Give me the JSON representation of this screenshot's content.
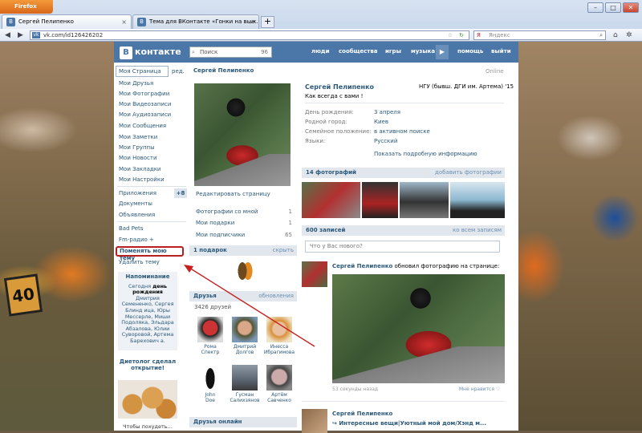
{
  "browser": {
    "app_button": "Firefox",
    "tabs": [
      {
        "title": "Сергей Пелипенко"
      },
      {
        "title": "Тема для ВКонтакте «Гонки на выж..."
      }
    ],
    "url": "vk.com/id126426202",
    "search_placeholder": "Яндекс"
  },
  "vk": {
    "logo": "контакте",
    "search_placeholder": "Поиск",
    "search_count": "96",
    "nav": [
      "люди",
      "сообщества",
      "игры",
      "музыка",
      "помощь",
      "выйти"
    ]
  },
  "sidebar": {
    "selected": "Моя Страница",
    "edit_short": "ред.",
    "items": [
      "Мои Друзья",
      "Мои Фотографии",
      "Мои Видеозаписи",
      "Мои Аудиозаписи",
      "Мои Сообщения",
      "Мои Заметки",
      "Мои Группы",
      "Мои Новости",
      "Мои Закладки",
      "Мои Настройки"
    ],
    "apps": [
      "Приложения",
      "Документы",
      "Объявления"
    ],
    "apps_badge": "+8",
    "extra": [
      "Bad Pets",
      "Fm-радио +"
    ],
    "change_theme": "Поменять мою тему",
    "delete_theme": "Удалить тему",
    "reminder": {
      "title": "Напоминание",
      "pre": "Сегодня",
      "bold": "день рождения",
      "names": "Дмитрия Семененко, Сергея Блинд ица, Юры Мессерле, Миши Подоляка, Эльдара Абзалова, Юлии Суворовой, Артема Барехович а."
    },
    "ad_title": "Диетолог сделал открытие!",
    "ad_caption": "Чтобы похудеть..."
  },
  "profile": {
    "header_name": "Сергей Пелипенко",
    "online": "Online",
    "name": "Сергей Пелипенко",
    "university": "НГУ (бывш. ДГИ им. Артема) '15",
    "status": "Как всегда с вами !",
    "info": [
      {
        "k": "День рождения:",
        "v": "3 апреля"
      },
      {
        "k": "Родной город:",
        "v": "Киев"
      },
      {
        "k": "Семейное положение:",
        "v": "в активном поиске"
      },
      {
        "k": "Языки:",
        "v": "Русский"
      }
    ],
    "show_more": "Показать подробную информацию",
    "edit_page": "Редактировать страницу",
    "meta": [
      {
        "label": "Фотографии со мной",
        "count": "1"
      },
      {
        "label": "Мои подарки",
        "count": "1"
      },
      {
        "label": "Мои подписчики",
        "count": "65"
      }
    ],
    "gifts_head": "1 подарок",
    "gifts_hide": "скрыть",
    "friends_head": "Друзья",
    "friends_updates": "обновления",
    "friends_count": "3426 друзей",
    "friends": [
      {
        "first": "Рома",
        "last": "Спектр"
      },
      {
        "first": "Дмитрий",
        "last": "Долгов"
      },
      {
        "first": "Инесса",
        "last": "Ибрагимова"
      },
      {
        "first": "John",
        "last": "Doe"
      },
      {
        "first": "Гусман",
        "last": "Салихзянов"
      },
      {
        "first": "Артём",
        "last": "Савченко"
      }
    ],
    "friends_online": "Друзья онлайн",
    "photos_head": "14 фотографий",
    "add_photo": "добавить фотографии",
    "wall_head": "600 записей",
    "wall_all": "ко всем записям",
    "wall_placeholder": "Что у Вас нового?",
    "post1": {
      "author": "Сергей Пелипенко",
      "text": "обновил фотографию на странице:",
      "time": "53 секунды назад",
      "like": "Мне нравится"
    },
    "post2": {
      "author": "Сергей Пелипенко",
      "text": "Интересные вещи|Уютный мой дом/Хэнд м..."
    }
  },
  "colors": {
    "vk_blue": "#4a76a8",
    "link": "#2b587a",
    "highlight": "#b62020"
  }
}
